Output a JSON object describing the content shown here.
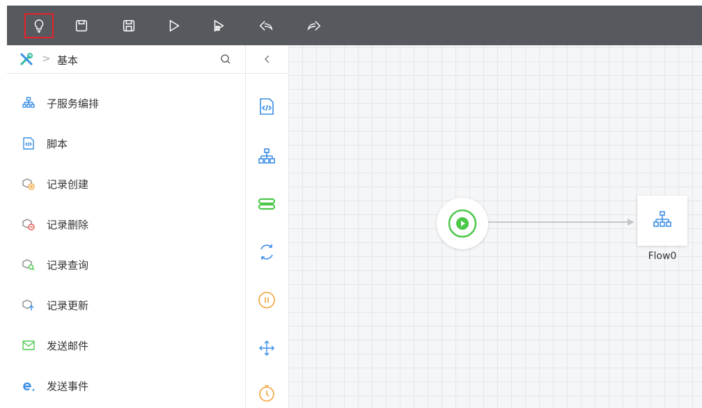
{
  "toolbar": {
    "buttons": [
      {
        "icon": "lightbulb-icon",
        "active": true
      },
      {
        "icon": "save-icon"
      },
      {
        "icon": "save-as-icon"
      },
      {
        "icon": "run-icon"
      },
      {
        "icon": "debug-icon"
      },
      {
        "icon": "undo-icon"
      },
      {
        "icon": "redo-icon"
      }
    ]
  },
  "left_panel": {
    "breadcrumb": {
      "separator": ">",
      "label": "基本"
    },
    "items": [
      {
        "label": "子服务编排",
        "icon": "sub-service-orchestration-icon"
      },
      {
        "label": "脚本",
        "icon": "script-icon"
      },
      {
        "label": "记录创建",
        "icon": "record-create-icon"
      },
      {
        "label": "记录删除",
        "icon": "record-delete-icon"
      },
      {
        "label": "记录查询",
        "icon": "record-query-icon"
      },
      {
        "label": "记录更新",
        "icon": "record-update-icon"
      },
      {
        "label": "发送邮件",
        "icon": "send-mail-icon"
      },
      {
        "label": "发送事件",
        "icon": "send-event-icon"
      }
    ]
  },
  "palette": {
    "items": [
      {
        "icon": "script-icon"
      },
      {
        "icon": "sub-flow-icon"
      },
      {
        "icon": "toggle-icon"
      },
      {
        "icon": "loop-icon"
      },
      {
        "icon": "pause-icon"
      },
      {
        "icon": "move-icon"
      },
      {
        "icon": "timer-icon"
      }
    ]
  },
  "canvas": {
    "nodes": [
      {
        "type": "start",
        "icon": "play-icon"
      },
      {
        "type": "sub-flow",
        "icon": "sub-flow-icon",
        "label": "Flow0"
      }
    ]
  },
  "colors": {
    "toolbar_bg": "#565a5f",
    "accent_blue": "#3a8ee6",
    "accent_green": "#4cc74a",
    "accent_orange": "#f0a33a",
    "active_border": "#e8212a"
  }
}
